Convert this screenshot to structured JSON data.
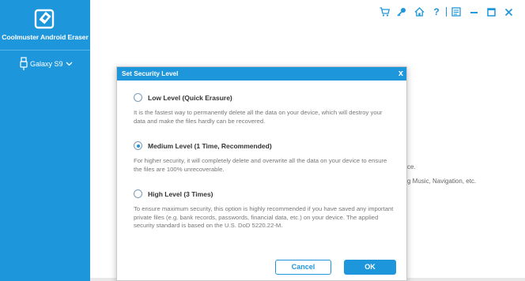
{
  "app": {
    "name": "Coolmuster Android Eraser",
    "device": "Galaxy S9"
  },
  "background_text": {
    "line1": "ce.",
    "line2": "g Music, Navigation, etc."
  },
  "dialog": {
    "title": "Set Security Level",
    "close": "x",
    "options": [
      {
        "label": "Low Level (Quick Erasure)",
        "checked": false,
        "description": "It is the fastest way to permanently delete all the data on your device, which will destroy your data and make the files hardly can be recovered."
      },
      {
        "label": "Medium Level (1 Time, Recommended)",
        "checked": true,
        "description": "For higher security, it will completely delete and overwrite all the data on your device to ensure the files are 100% unrecoverable."
      },
      {
        "label": "High Level (3 Times)",
        "checked": false,
        "description": "To ensure maximum security, this option is highly recommended if you have saved any important private files (e.g. bank records, passwords, financial data, etc.) on your device. The applied security standard is based on the U.S. DoD 5220.22-M."
      }
    ],
    "cancel_label": "Cancel",
    "ok_label": "OK"
  },
  "toolbar": {
    "help": "?",
    "icons": [
      "cart-icon",
      "key-icon",
      "home-icon",
      "help-icon",
      "feedback-icon",
      "minimize-icon",
      "maximize-icon",
      "close-icon"
    ]
  },
  "colors": {
    "accent": "#1e96dc"
  }
}
